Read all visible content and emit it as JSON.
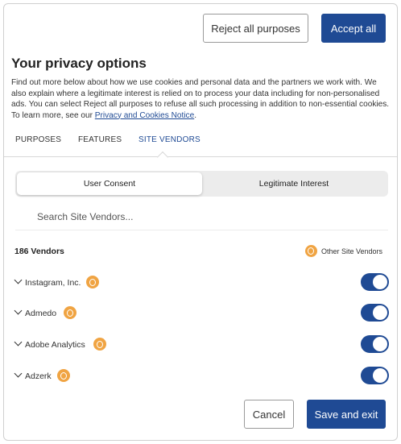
{
  "header": {
    "reject_label": "Reject all purposes",
    "accept_label": "Accept all"
  },
  "title": "Your privacy options",
  "description": {
    "text": "Find out more below about how we use cookies and personal data and the partners we work with. We also explain where a legitimate interest is relied on to process your data including for non-personalised ads. You can select Reject all purposes to refuse all such processing in addition to non-essential cookies. To learn more, see our ",
    "link_text": "Privacy and Cookies Notice",
    "suffix": "."
  },
  "tabs": {
    "purposes": "PURPOSES",
    "features": "FEATURES",
    "vendors": "SITE VENDORS",
    "active": "SITE VENDORS"
  },
  "segment": {
    "user_consent": "User Consent",
    "legitimate_interest": "Legitimate Interest",
    "selected": "User Consent"
  },
  "search": {
    "placeholder": "Search Site Vendors..."
  },
  "vendors": {
    "count_label": "186 Vendors",
    "legend_label": "Other Site Vendors",
    "items": [
      {
        "name": "Instagram, Inc.",
        "enabled": true
      },
      {
        "name": "Admedo",
        "enabled": true
      },
      {
        "name": "Adobe Analytics",
        "enabled": true
      },
      {
        "name": "Adzerk",
        "enabled": true
      }
    ]
  },
  "footer": {
    "cancel_label": "Cancel",
    "save_label": "Save and exit"
  },
  "colors": {
    "primary": "#1f4a94",
    "badge": "#f0a443"
  }
}
